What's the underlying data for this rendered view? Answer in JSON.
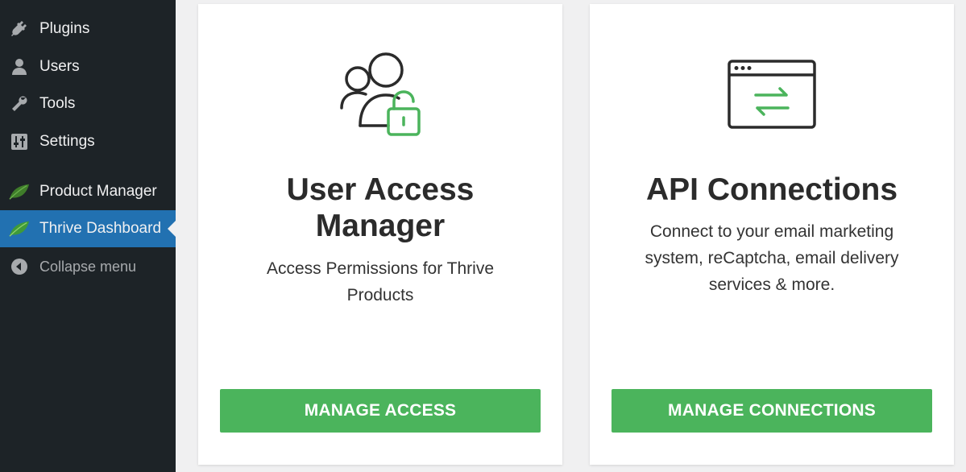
{
  "sidebar": {
    "items": [
      {
        "label": "Plugins",
        "icon": "plugin-icon"
      },
      {
        "label": "Users",
        "icon": "users-icon"
      },
      {
        "label": "Tools",
        "icon": "wrench-icon"
      },
      {
        "label": "Settings",
        "icon": "settings-sliders-icon"
      },
      {
        "label": "Product Manager",
        "icon": "leaf-icon"
      },
      {
        "label": "Thrive Dashboard",
        "icon": "leaf-icon",
        "active": true
      },
      {
        "label": "Collapse menu",
        "icon": "collapse-arrow-icon"
      }
    ],
    "colors": {
      "background": "#1d2327",
      "active": "#2271b1"
    }
  },
  "cards": [
    {
      "title": "User Access Manager",
      "description": "Access Permissions for Thrive Products",
      "button": "MANAGE ACCESS",
      "icon": "users-lock-icon"
    },
    {
      "title": "API Connections",
      "description": "Connect to your email marketing system, reCaptcha, email delivery services & more.",
      "button": "MANAGE CONNECTIONS",
      "icon": "browser-exchange-icon"
    }
  ],
  "colors": {
    "accent": "#4bb45c",
    "page_bg": "#f0f0f1"
  }
}
